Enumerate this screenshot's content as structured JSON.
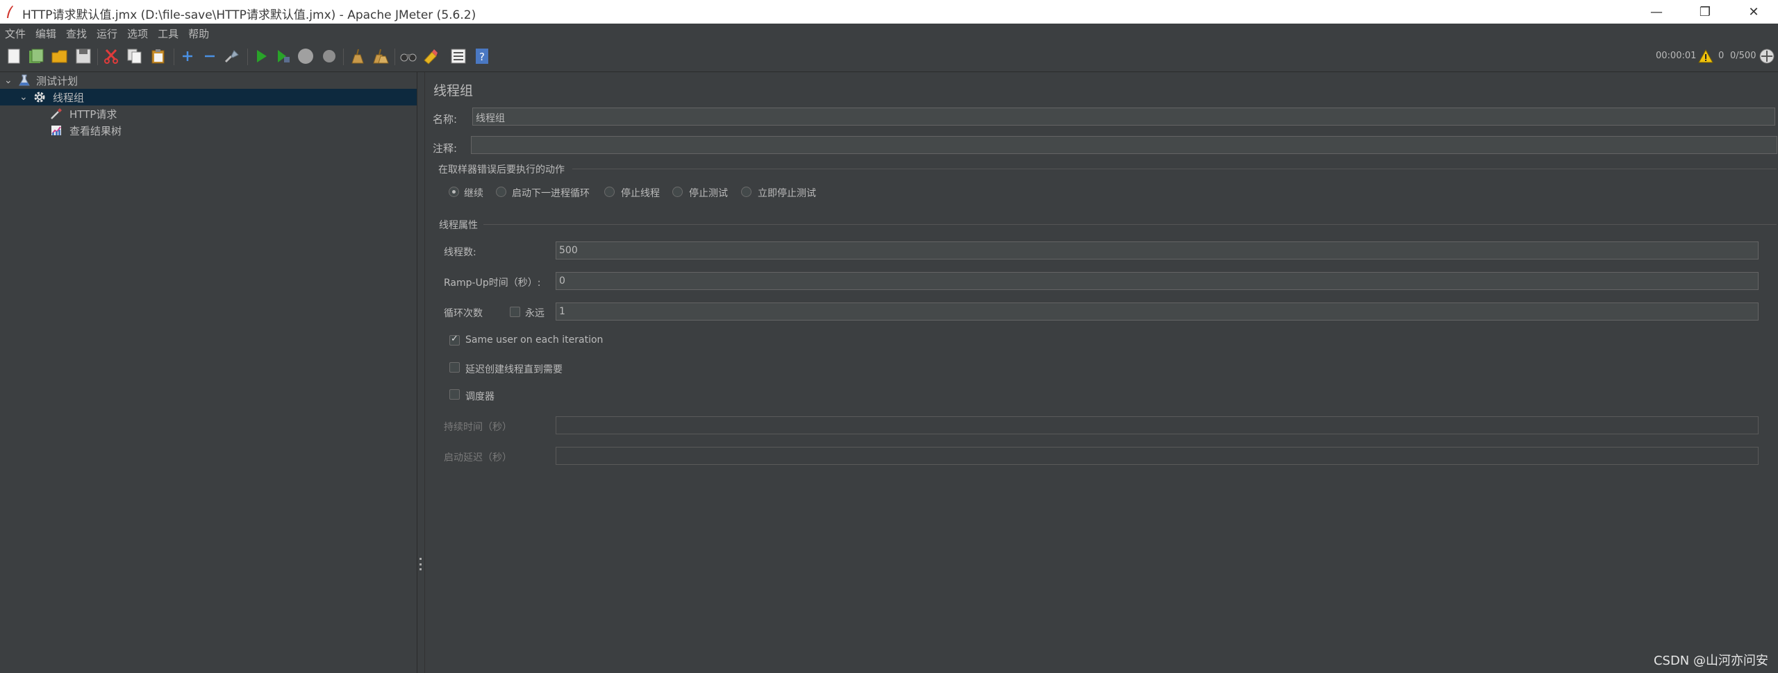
{
  "window": {
    "title": "HTTP请求默认值.jmx (D:\\file-save\\HTTP请求默认值.jmx) - Apache JMeter (5.6.2)",
    "minimize": "—",
    "restore": "❐",
    "close": "✕"
  },
  "menubar": {
    "items": [
      "文件",
      "编辑",
      "查找",
      "运行",
      "选项",
      "工具",
      "帮助"
    ]
  },
  "toolbar": {
    "elapsed": "00:00:01",
    "warnings": "0",
    "threads": "0/500"
  },
  "tree": {
    "items": [
      {
        "label": "测试计划",
        "icon": "flask-icon"
      },
      {
        "label": "线程组",
        "icon": "gear-icon"
      },
      {
        "label": "HTTP请求",
        "icon": "pipette-icon"
      },
      {
        "label": "查看结果树",
        "icon": "chart-icon"
      }
    ]
  },
  "main": {
    "title": "线程组",
    "name_label": "名称:",
    "name_value": "线程组",
    "comment_label": "注释:",
    "comment_value": "",
    "error_action_title": "在取样器错误后要执行的动作",
    "error_actions": [
      "继续",
      "启动下一进程循环",
      "停止线程",
      "停止测试",
      "立即停止测试"
    ],
    "selected_error_action": "继续",
    "thread_props_title": "线程属性",
    "threads_label": "线程数:",
    "threads_value": "500",
    "rampup_label": "Ramp-Up时间（秒）:",
    "rampup_value": "0",
    "loop_label": "循环次数",
    "forever_label": "永远",
    "forever_checked": false,
    "loop_value": "1",
    "same_user_label": "Same user on each iteration",
    "same_user_checked": true,
    "delay_label": "延迟创建线程直到需要",
    "delay_checked": false,
    "scheduler_label": "调度器",
    "scheduler_checked": false,
    "duration_label": "持续时间（秒）",
    "duration_value": "",
    "startup_delay_label": "启动延迟（秒）",
    "startup_delay_value": ""
  },
  "watermark": "CSDN @山河亦问安",
  "colors": {
    "background": "#3c3f41",
    "selection": "#0d293e",
    "text": "#bbbbbb",
    "field_bg": "#45494a"
  }
}
